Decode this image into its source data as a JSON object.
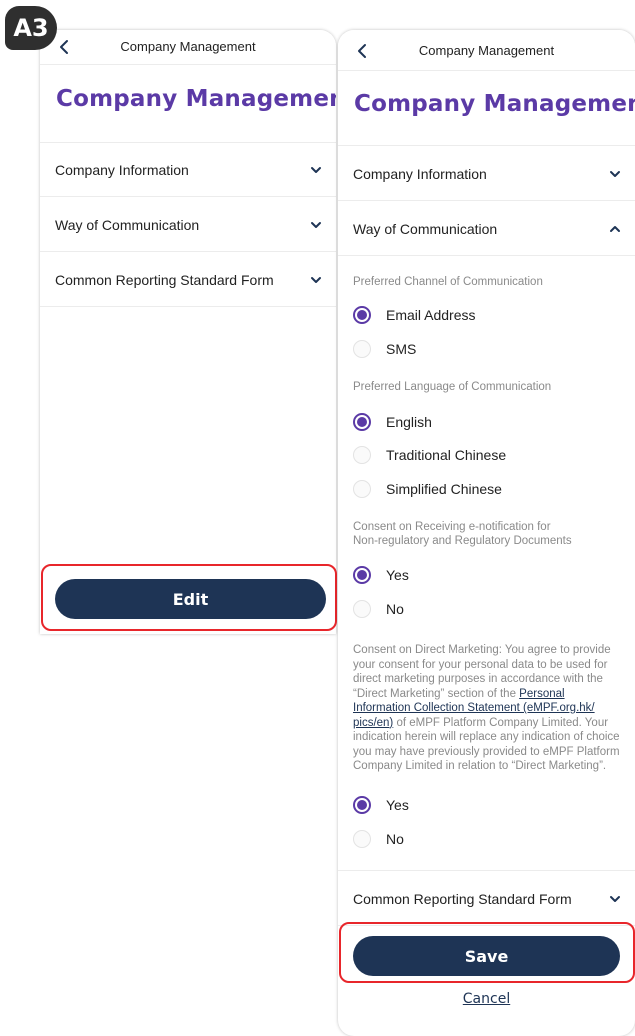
{
  "badge": "A3",
  "left": {
    "nav_title": "Company Management",
    "page_title": "Company Management",
    "sections": [
      "Company Information",
      "Way of Communication",
      "Common Reporting Standard Form"
    ],
    "edit_label": "Edit"
  },
  "right": {
    "nav_title": "Company Management",
    "page_title": "Company Management",
    "sections": {
      "company_info": "Company Information",
      "way_of_comm": "Way of Communication",
      "crs_form": "Common Reporting Standard Form"
    },
    "channel": {
      "label": "Preferred Channel of Communication",
      "options": [
        "Email Address",
        "SMS"
      ],
      "selected": "Email Address"
    },
    "language": {
      "label": "Preferred Language of Communication",
      "options": [
        "English",
        "Traditional Chinese",
        "Simplified Chinese"
      ],
      "selected": "English"
    },
    "enotification": {
      "label_line1": "Consent on Receiving e-notification for",
      "label_line2": "Non-regulatory and Regulatory Documents",
      "options": [
        "Yes",
        "No"
      ],
      "selected": "Yes"
    },
    "direct_marketing": {
      "text_before": "Consent on Direct Marketing: You agree to provide your consent for your personal data to be used for direct marketing purposes in accordance with the “Direct Marketing” section of the ",
      "link_text": "Personal Information Collection Statement (eMPF.org.hk/ pics/en)",
      "text_after": " of eMPF Platform Company Limited. Your indication herein will replace any indication of choice you may have previously provided to eMPF Platform Company Limited in relation to “Direct Marketing”.",
      "options": [
        "Yes",
        "No"
      ],
      "selected": "Yes"
    },
    "save_label": "Save",
    "cancel_label": "Cancel"
  },
  "colors": {
    "title_purple": "#5b3aa6",
    "button_navy": "#1e3455",
    "highlight_red": "#e8262b"
  }
}
